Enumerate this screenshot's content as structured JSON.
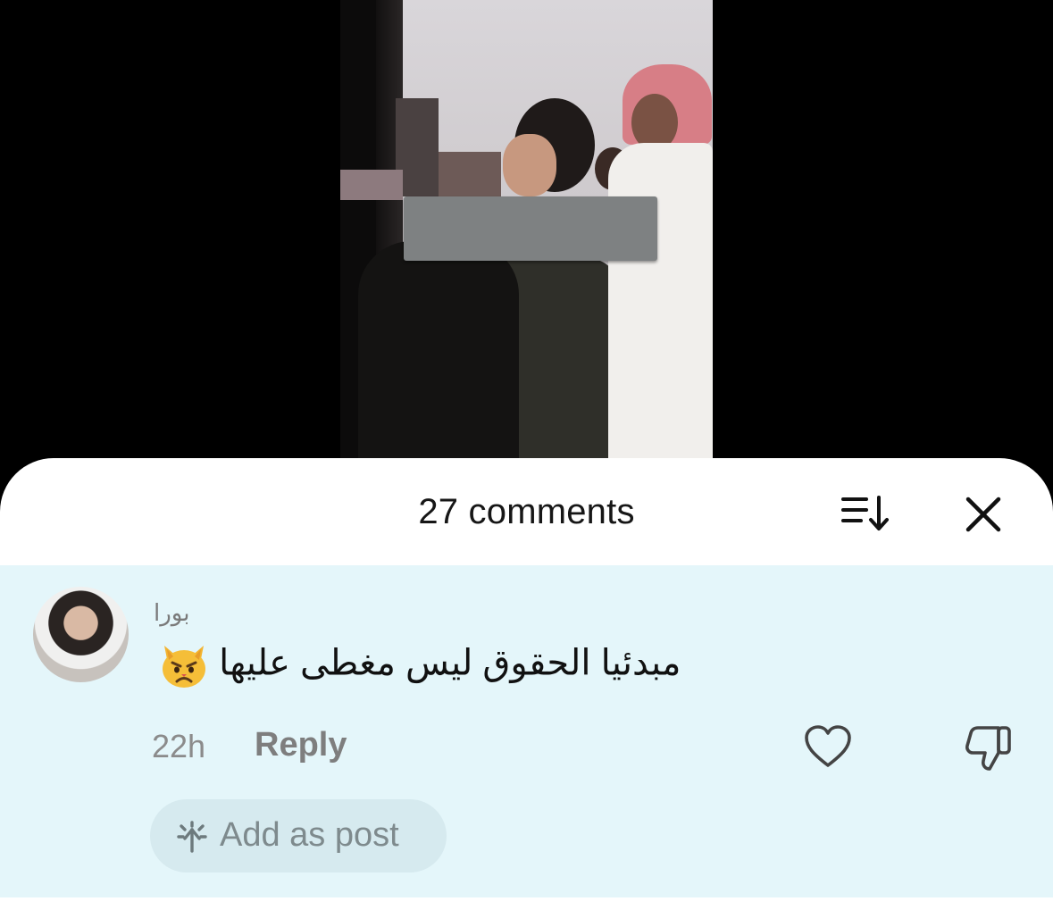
{
  "comments_sheet": {
    "title": "27 comments",
    "sort_icon": "sort-descending-icon",
    "close_icon": "close-icon"
  },
  "comment": {
    "username": "بورا",
    "text": "مبدئيا الحقوق ليس مغطى عليها",
    "emoji": "pouting-cat-emoji",
    "time": "22h",
    "reply_label": "Reply",
    "like_icon": "heart-icon",
    "dislike_icon": "thumbs-down-icon",
    "add_as_post_label": "Add as post"
  },
  "colors": {
    "highlight_background": "#e4f6fa",
    "sheet_background": "#ffffff",
    "muted_text": "#7e7e7e"
  }
}
